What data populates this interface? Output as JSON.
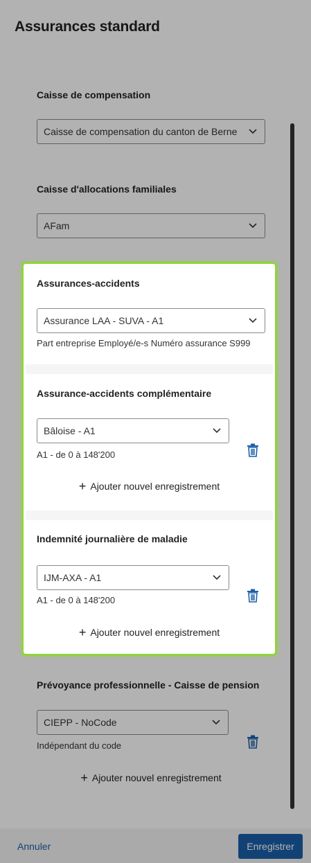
{
  "page": {
    "title": "Assurances standard"
  },
  "sections": {
    "caisse_compensation": {
      "title": "Caisse de compensation",
      "selected": "Caisse de compensation du canton de Berne"
    },
    "allocations_familiales": {
      "title": "Caisse d'allocations familiales",
      "selected": "AFam"
    },
    "accidents": {
      "title": "Assurances-accidents",
      "selected": "Assurance LAA - SUVA - A1",
      "detail": "Part entreprise Employé/e-s Numéro assurance S999"
    },
    "accidents_complementaire": {
      "title": "Assurance-accidents complémentaire",
      "selected": "Bâloise - A1",
      "detail": "A1 - de 0 à 148'200",
      "add_label": "Ajouter nouvel enregistrement"
    },
    "indemnite_maladie": {
      "title": "Indemnité journalière de maladie",
      "selected": "IJM-AXA - A1",
      "detail": "A1 - de 0 à 148'200",
      "add_label": "Ajouter nouvel enregistrement"
    },
    "prevoyance": {
      "title": "Prévoyance professionnelle - Caisse de pension",
      "selected": "CIEPP - NoCode",
      "detail": "Indépendant du code",
      "add_label": "Ajouter nouvel enregistrement"
    }
  },
  "footer": {
    "cancel_label": "Annuler",
    "save_label": "Enregistrer"
  },
  "icons": {
    "chevron": "chevron-down-icon",
    "trash": "trash-icon",
    "plus": "plus-icon"
  },
  "colors": {
    "accent": "#1a5fa8",
    "highlight": "#8fd43c",
    "overlay": "rgba(0,0,0,0.30)"
  }
}
